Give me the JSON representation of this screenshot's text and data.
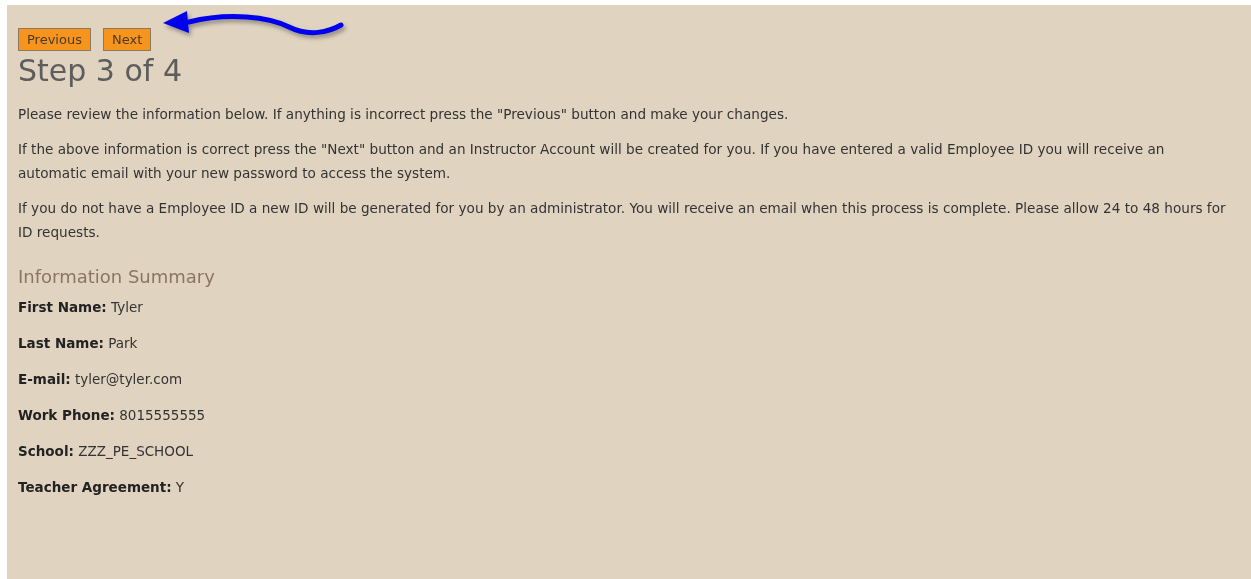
{
  "buttons": [
    {
      "label": "Previous"
    },
    {
      "label": "Next"
    }
  ],
  "heading": "Step 3 of 4",
  "paragraphs": [
    "Please review the information below. If anything is incorrect press the \"Previous\" button and make your changes.",
    "If the above information is correct press the \"Next\" button and an Instructor Account will be created for you. If you have entered a valid Employee ID you will receive an automatic email with your new password to access the system.",
    "If you do not have a Employee ID a new ID will be generated for you by an administrator. You will receive an email when this process is complete. Please allow 24 to 48 hours for ID requests."
  ],
  "summary": {
    "title": "Information Summary",
    "fields": [
      {
        "label": "First Name:",
        "value": "Tyler"
      },
      {
        "label": "Last Name:",
        "value": "Park"
      },
      {
        "label": "E-mail:",
        "value": "tyler@tyler.com"
      },
      {
        "label": "Work Phone:",
        "value": "8015555555"
      },
      {
        "label": "School:",
        "value": "ZZZ_PE_SCHOOL"
      },
      {
        "label": "Teacher Agreement:",
        "value": "Y"
      }
    ]
  }
}
